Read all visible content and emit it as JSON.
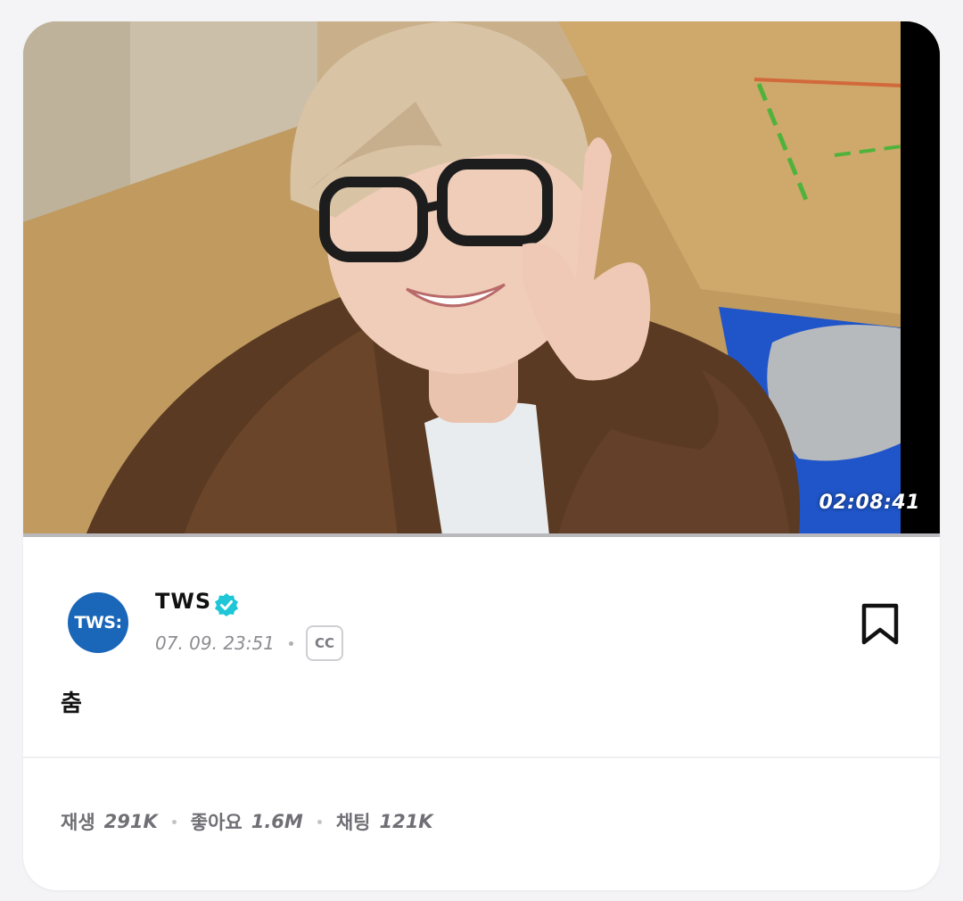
{
  "video": {
    "duration": "02:08:41"
  },
  "channel": {
    "avatar_text": "TWS:",
    "name": "TWS",
    "verified": true,
    "date": "07. 09. 23:51",
    "cc_label": "CC"
  },
  "post": {
    "caption": "춤"
  },
  "stats": {
    "plays_label": "재생",
    "plays_value": "291K",
    "likes_label": "좋아요",
    "likes_value": "1.6M",
    "chats_label": "채팅",
    "chats_value": "121K"
  },
  "colors": {
    "avatar_bg": "#1a66b8",
    "verified": "#1ec6d8",
    "text_primary": "#111111",
    "text_secondary": "#8d8d92"
  },
  "icons": {
    "verified": "verified-badge-icon",
    "bookmark": "bookmark-icon"
  }
}
